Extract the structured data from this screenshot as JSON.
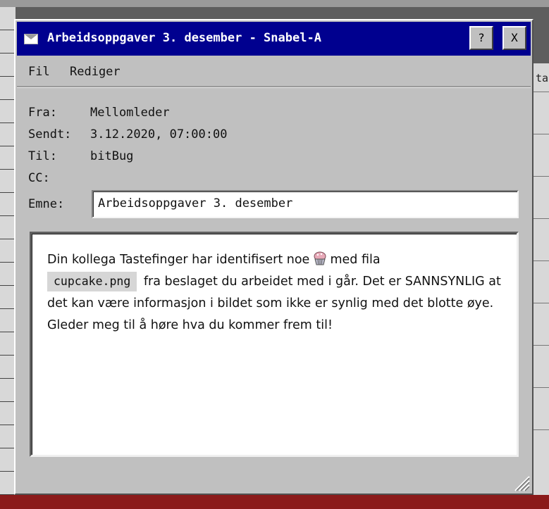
{
  "window": {
    "title": "Arbeidsoppgaver 3. desember - Snabel-A",
    "help_button": "?",
    "close_button": "X"
  },
  "menu": {
    "file": "Fil",
    "edit": "Rediger"
  },
  "headers": {
    "from_label": "Fra:",
    "from_value": "Mellomleder",
    "sent_label": "Sendt:",
    "sent_value": "3.12.2020, 07:00:00",
    "to_label": "Til:",
    "to_value": "bitBug",
    "cc_label": "CC:",
    "cc_value": "",
    "subject_label": "Emne:",
    "subject_value": "Arbeidsoppgaver 3. desember"
  },
  "message": {
    "text_before_icon": "Din kollega Tastefinger har identifisert noe",
    "text_after_icon": "med fila",
    "attachment": "cupcake.png",
    "text_rest": "fra beslaget du arbeidet med i går. Det er SANNSYNLIG at det kan være informasjon i bildet som ikke er synlig med det blotte øye. Gleder meg til å høre hva du kommer frem til!"
  },
  "background": {
    "right_partial_header": "ta"
  }
}
